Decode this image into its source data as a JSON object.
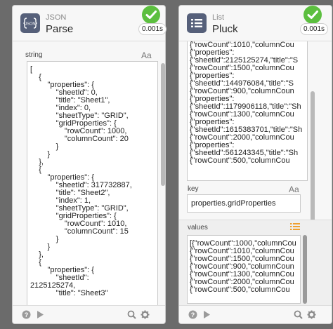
{
  "left_card": {
    "category": "JSON",
    "title": "Parse",
    "icon": "json-icon",
    "badge": "0.001s",
    "status": "success-check-icon",
    "field_label": "string",
    "aa_label": "Aa",
    "content": "[\n    {\n        \"properties\": {\n            \"sheetId\": 0,\n            \"title\": \"Sheet1\",\n            \"index\": 0,\n            \"sheetType\": \"GRID\",\n            \"gridProperties\": {\n                \"rowCount\": 1000,\n                \"columnCount\": 20\n            }\n        }\n    },\n    {\n        \"properties\": {\n            \"sheetId\": 317732887,\n            \"title\": \"Sheet2\",\n            \"index\": 1,\n            \"sheetType\": \"GRID\",\n            \"gridProperties\": {\n                \"rowCount\": 1010,\n                \"columnCount\": 15\n            }\n        }\n    },\n    {\n        \"properties\": {\n            \"sheetId\":\n2125125274,\n            \"title\": \"Sheet3\""
  },
  "right_card": {
    "category": "List",
    "title": "Pluck",
    "icon": "list-icon",
    "badge": "0.001s",
    "status": "success-check-icon",
    "top_content": "{\"rowCount\":1010,\"columnCou\n{\"properties\":\n{\"sheetId\":2125125274,\"title\":\"S\n{\"rowCount\":1500,\"columnCou\n{\"properties\":\n{\"sheetId\":144976084,\"title\":\"S\n{\"rowCount\":900,\"columnCoun\n{\"properties\":\n{\"sheetId\":1179906118,\"title\":\"Sh\n{\"rowCount\":1300,\"columnCou\n{\"properties\":\n{\"sheetId\":1615383701,\"title\":\"Sh\n{\"rowCount\":2000,\"columnCou\n{\"properties\":\n{\"sheetId\":561243345,\"title\":\"Sh\n{\"rowCount\":500,\"columnCou",
    "key_label": "key",
    "aa_label": "Aa",
    "key_value": "properties.gridProperties",
    "values_label": "values",
    "values_content": "[{\"rowCount\":1000,\"columnCou\n{\"rowCount\":1010,\"columnCou\n{\"rowCount\":1500,\"columnCou\n{\"rowCount\":900,\"columnCoun\n{\"rowCount\":1300,\"columnCou\n{\"rowCount\":2000,\"columnCou\n{\"rowCount\":500,\"columnCou"
  },
  "colors": {
    "icon_bg": "#56607a",
    "success": "#5cbf3f",
    "canvas": "#6b6b6b",
    "list_accent": "#f0a030"
  }
}
